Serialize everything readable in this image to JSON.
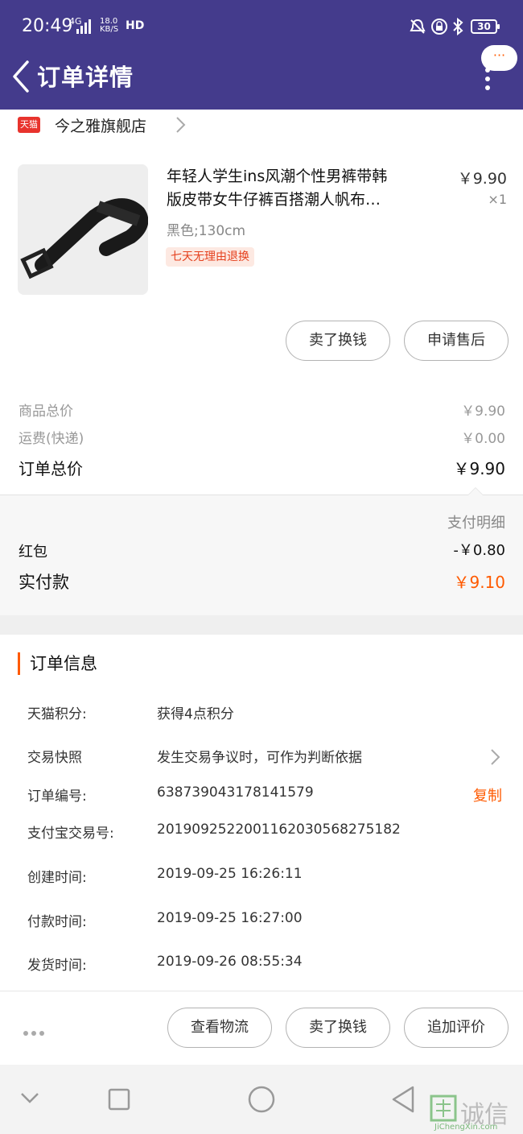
{
  "status_bar": {
    "time": "20:49",
    "network": "4G",
    "speed_value": "18.0",
    "speed_unit": "KB/S",
    "hd": "HD",
    "battery": "30"
  },
  "header": {
    "title": "订单详情",
    "more_bubble": "···"
  },
  "store": {
    "badge": "天猫",
    "name": "今之雅旗舰店"
  },
  "product": {
    "title_line1": "年轻人学生ins风潮个性男裤带韩",
    "title_line2": "版皮带女牛仔裤百搭潮人帆布…",
    "price": "￥9.90",
    "quantity": "×1",
    "spec": "黑色;130cm",
    "tag": "七天无理由退换"
  },
  "product_actions": {
    "sell_label": "卖了换钱",
    "after_sale_label": "申请售后"
  },
  "summary": {
    "goods_total_label": "商品总价",
    "goods_total_value": "￥9.90",
    "shipping_label": "运费(快递)",
    "shipping_value": "￥0.00",
    "order_total_label": "订单总价",
    "order_total_value": "￥9.90"
  },
  "payment": {
    "detail_label": "支付明细",
    "red_packet_label": "红包",
    "red_packet_value": "-￥0.80",
    "paid_label": "实付款",
    "paid_value": "￥9.10",
    "accent_color": "#ff5a00"
  },
  "order_info": {
    "section_title": "订单信息",
    "rows": [
      {
        "key": "天猫积分:",
        "value": "获得4点积分"
      },
      {
        "key": "交易快照",
        "value": "发生交易争议时，可作为判断依据"
      },
      {
        "key": "订单编号:",
        "value": "638739043178141579"
      },
      {
        "key": "支付宝交易号:",
        "value": "2019092522001162030568275182"
      },
      {
        "key": "创建时间:",
        "value": "2019-09-25 16:26:11"
      },
      {
        "key": "付款时间:",
        "value": "2019-09-25 16:27:00"
      },
      {
        "key": "发货时间:",
        "value": "2019-09-26 08:55:34"
      }
    ],
    "copy_label": "复制"
  },
  "bottom_actions": {
    "logistics_label": "查看物流",
    "sell_label": "卖了换钱",
    "review_label": "追加评价"
  },
  "watermark": {
    "text": "诚信",
    "sub": "JiChengXin.com"
  },
  "colors": {
    "header_bg": "#443b8c",
    "tmall_red": "#e8332d"
  }
}
